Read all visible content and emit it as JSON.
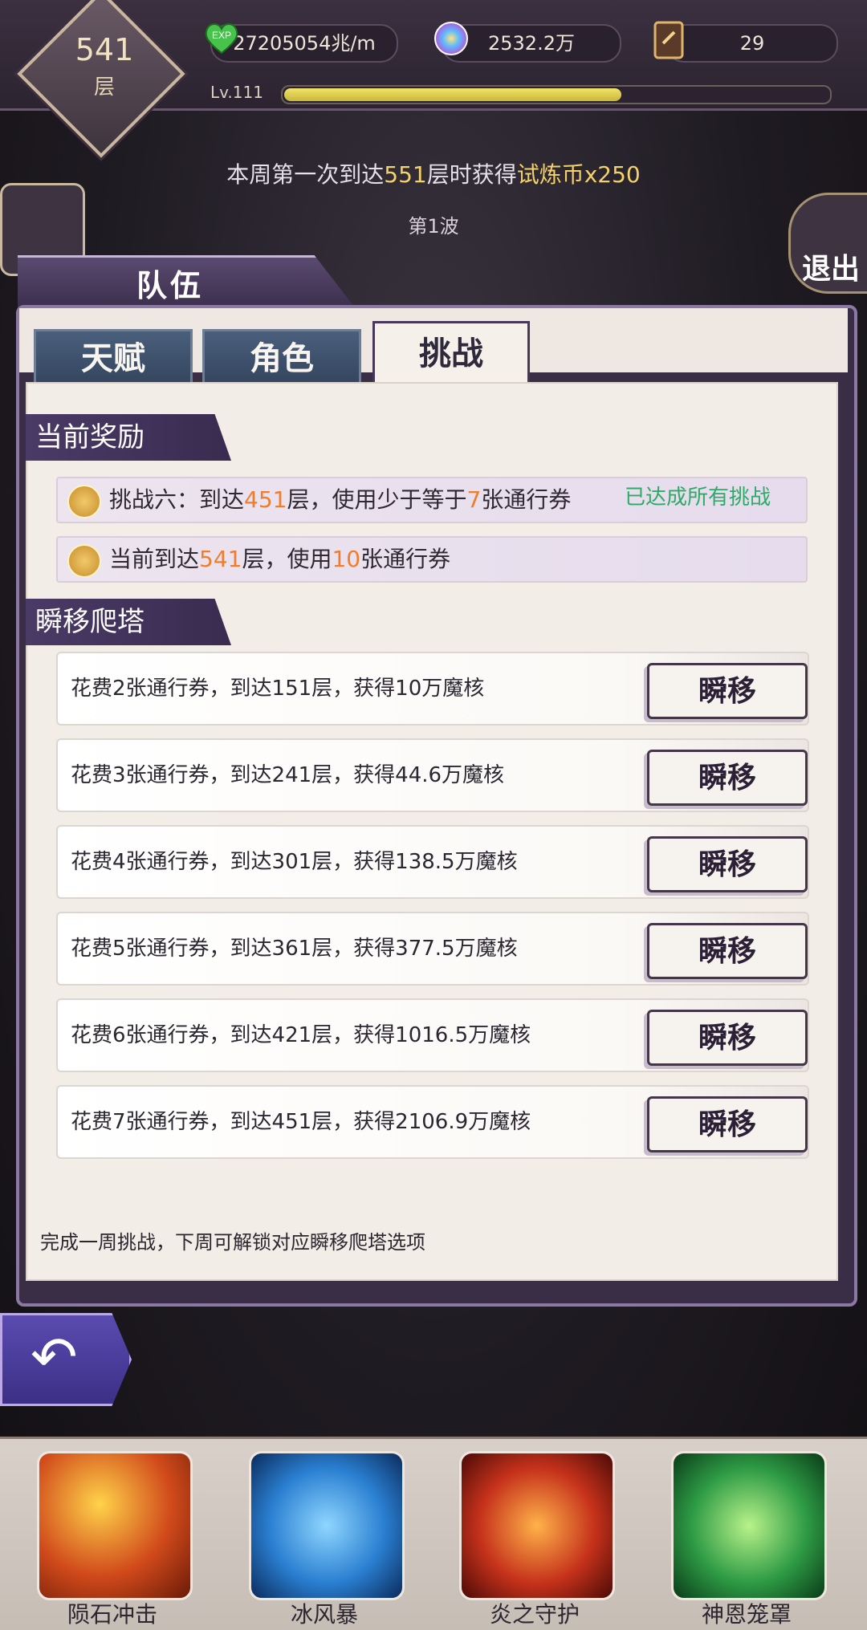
{
  "top": {
    "floor": {
      "value": "541",
      "unit": "层"
    },
    "exp": "27205054兆/m",
    "orb": "2532.2万",
    "cards": "29",
    "level": {
      "label": "Lv.111",
      "progress": 0.62
    }
  },
  "notice": {
    "prefix": "本周第一次到达",
    "floor": "551",
    "mid": "层时获得",
    "reward": "试炼币x250"
  },
  "wave": "第1波",
  "exit": "退出",
  "team": {
    "title": "队伍"
  },
  "tabs": [
    {
      "label": "天赋"
    },
    {
      "label": "角色"
    },
    {
      "label": "挑战"
    }
  ],
  "current_reward": {
    "title": "当前奖励",
    "row1": {
      "a": "挑战六：到达",
      "b": "451",
      "c": "层，使用少于等于",
      "d": "7",
      "e": "张通行券"
    },
    "row1_status": "已达成所有挑战",
    "row2": {
      "a": "当前到达",
      "b": "541",
      "c": "层，使用",
      "d": "10",
      "e": "张通行券"
    }
  },
  "teleport": {
    "title": "瞬移爬塔",
    "button_label": "瞬移",
    "rows": [
      "花费2张通行券，到达151层，获得10万魔核",
      "花费3张通行券，到达241层，获得44.6万魔核",
      "花费4张通行券，到达301层，获得138.5万魔核",
      "花费5张通行券，到达361层，获得377.5万魔核",
      "花费6张通行券，到达421层，获得1016.5万魔核",
      "花费7张通行券，到达451层，获得2106.9万魔核"
    ],
    "footer": "完成一周挑战，下周可解锁对应瞬移爬塔选项"
  },
  "skills": [
    {
      "label": "陨石冲击"
    },
    {
      "label": "冰风暴"
    },
    {
      "label": "炎之守护"
    },
    {
      "label": "神恩笼罩"
    }
  ]
}
